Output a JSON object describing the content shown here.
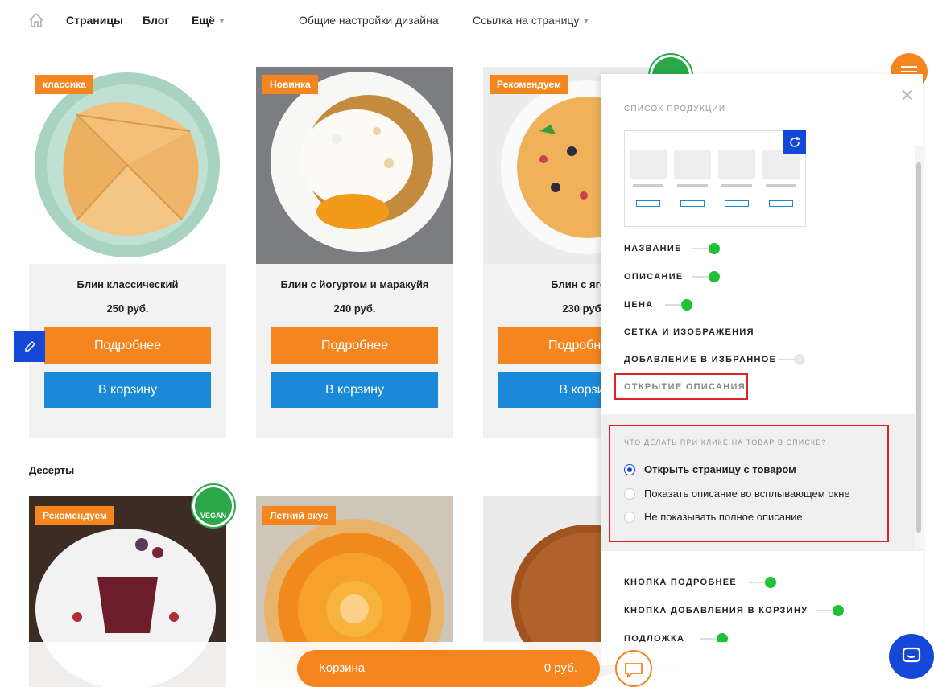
{
  "nav": {
    "items": [
      {
        "label": "Страницы"
      },
      {
        "label": "Блог"
      },
      {
        "label": "Ещё"
      }
    ],
    "design_settings": "Общие настройки дизайна",
    "page_link": "Ссылка на страницу"
  },
  "products": [
    {
      "badge": "классика",
      "title": "Блин классический",
      "price": "250 руб.",
      "more": "Подробнее",
      "cart": "В корзину"
    },
    {
      "badge": "Новинка",
      "title": "Блин с йогуртом и маракуйя",
      "price": "240 руб.",
      "more": "Подробнее",
      "cart": "В корзину"
    },
    {
      "badge": "Рекомендуем",
      "title": "Блин с ягод",
      "price": "230 руб",
      "more": "Подробнее",
      "cart": "В корзи"
    }
  ],
  "desserts": {
    "title": "Десерты",
    "items": [
      {
        "badge": "Рекомендуем"
      },
      {
        "badge": "Летний вкус"
      }
    ]
  },
  "vegan_label": "VEGAN",
  "panel": {
    "heading": "СПИСОК ПРОДУКЦИИ",
    "options": [
      {
        "label": "НАЗВАНИЕ",
        "on": true
      },
      {
        "label": "ОПИСАНИЕ",
        "on": true
      },
      {
        "label": "ЦЕНА",
        "on": true
      },
      {
        "label": "СЕТКА И ИЗОБРАЖЕНИЯ"
      },
      {
        "label": "ДОБАВЛЕНИЕ В ИЗБРАННОЕ",
        "on": false
      },
      {
        "label": "ОТКРЫТИЕ ОПИСАНИЯ"
      }
    ],
    "click_section": {
      "heading": "ЧТО ДЕЛАТЬ ПРИ КЛИКЕ НА ТОВАР В СПИСКЕ?",
      "choices": [
        {
          "label": "Открыть страницу с товаром",
          "selected": true
        },
        {
          "label": "Показать описание во всплывающем окне",
          "selected": false
        },
        {
          "label": "Не показывать полное описание",
          "selected": false
        }
      ]
    },
    "options_bottom": [
      {
        "label": "КНОПКА ПОДРОБНЕЕ",
        "on": true
      },
      {
        "label": "КНОПКА ДОБАВЛЕНИЯ В КОРЗИНУ",
        "on": true
      },
      {
        "label": "ПОДЛОЖКА",
        "on": true
      }
    ]
  },
  "cart_bar": {
    "label": "Корзина",
    "sum": "0 руб."
  },
  "colors": {
    "accent": "#f5861f",
    "cart_button": "#1a8ad8",
    "editor_blue": "#1548d6",
    "toggle_on": "#1ec236",
    "highlight": "#e0202a"
  }
}
